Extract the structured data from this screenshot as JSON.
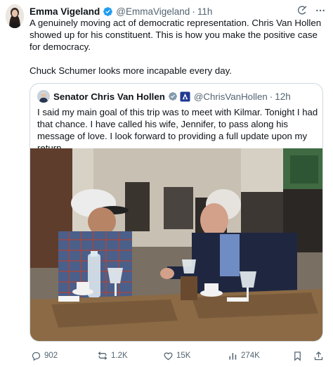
{
  "author": {
    "name": "Emma Vigeland",
    "handle": "@EmmaVigeland",
    "separator": "·",
    "time": "11h"
  },
  "tweet": {
    "paragraph1": "A genuinely moving act of democratic representation. Chris Van Hollen showed up for his constituent. This is how you make the positive case for democracy.",
    "paragraph2": "Chuck Schumer looks more incapable every day."
  },
  "quoted": {
    "name": "Senator Chris Van Hollen",
    "handle": "@ChrisVanHollen",
    "separator": "·",
    "time": "12h",
    "text": "I said my main goal of this trip was to meet with Kilmar. Tonight I had that chance. I have called his wife, Jennifer, to pass along his message of love. I look forward to providing a full update upon my return."
  },
  "actions": {
    "replies": "902",
    "reposts": "1.2K",
    "likes": "15K",
    "views": "274K"
  },
  "icons": {
    "verified": "verified-badge-icon",
    "gray_badge": "government-badge-icon",
    "gov_label": "capitol-label-icon",
    "grok": "grok-icon",
    "more": "more-icon",
    "reply": "reply-icon",
    "repost": "repost-icon",
    "like": "like-icon",
    "views": "views-icon",
    "bookmark": "bookmark-icon",
    "share": "share-icon"
  },
  "colors": {
    "accent": "#1d9bf0",
    "text": "#0f1419",
    "secondary": "#536471",
    "border": "#cfd9de"
  }
}
